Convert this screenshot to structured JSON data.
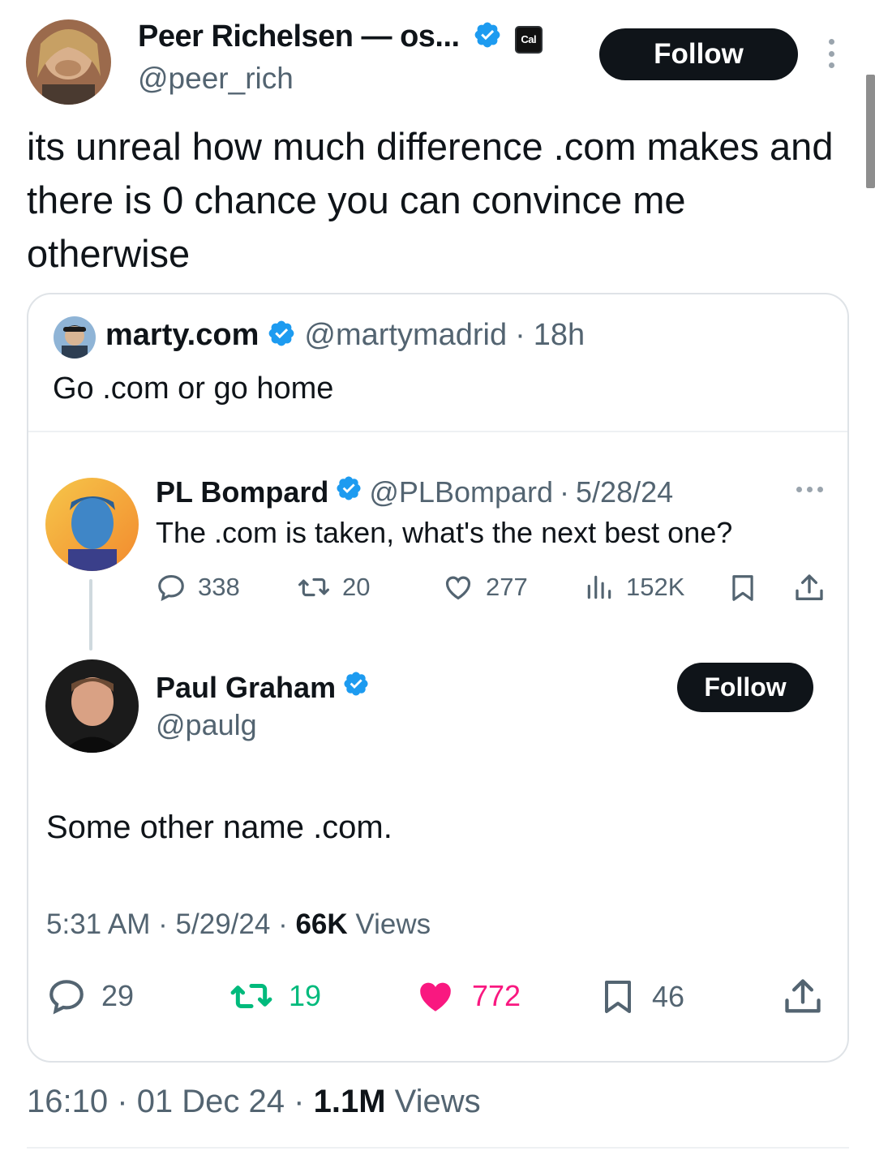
{
  "main_tweet": {
    "author_name": "Peer Richelsen — os...",
    "author_handle": "@peer_rich",
    "affiliate_badge": "Cal",
    "follow_label": "Follow",
    "text": "its unreal how much difference .com makes and there is 0 chance you can convince me otherwise",
    "time": "16:10",
    "date": "01 Dec 24",
    "views_count": "1.1M",
    "views_label": "Views",
    "sep": "·"
  },
  "quoted": {
    "author_name": "marty.com",
    "author_handle": "@martymadrid",
    "age": "18h",
    "text": "Go .com or go home"
  },
  "embedded_parent": {
    "author_name": "PL Bompard",
    "author_handle": "@PLBompard",
    "date": "5/28/24",
    "text": "The .com is taken, what's the next best one?",
    "replies": "338",
    "reposts": "20",
    "likes": "277",
    "views": "152K"
  },
  "embedded_reply": {
    "author_name": "Paul Graham",
    "author_handle": "@paulg",
    "follow_label": "Follow",
    "text": "Some other name .com.",
    "time": "5:31 AM",
    "date": "5/29/24",
    "views_count": "66K",
    "views_label": "Views",
    "replies": "29",
    "reposts": "19",
    "likes": "772",
    "bookmarks": "46"
  },
  "colors": {
    "verified_blue": "#1d9bf0",
    "repost_green": "#00ba7c",
    "like_pink": "#f91880",
    "text_primary": "#0f1419",
    "text_secondary": "#536471"
  },
  "icons": [
    "verified-badge-icon",
    "more-options-icon",
    "reply-icon",
    "repost-icon",
    "like-icon",
    "views-icon",
    "bookmark-icon",
    "share-icon"
  ]
}
